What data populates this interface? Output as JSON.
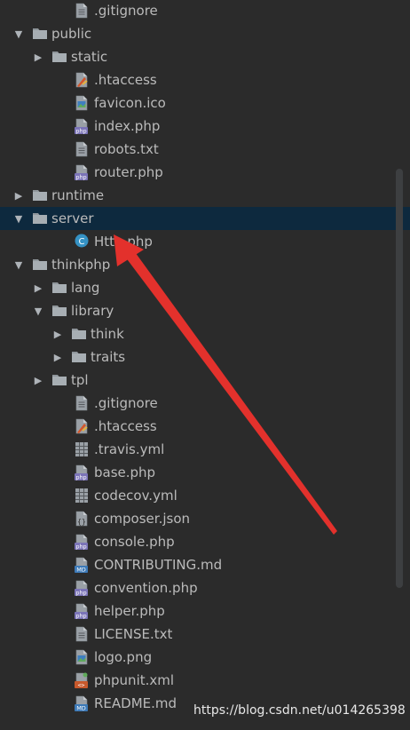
{
  "tree": [
    {
      "label": ".gitignore",
      "depth": 2,
      "arrow": "",
      "icon": "text-file-icon"
    },
    {
      "label": "public",
      "depth": 0,
      "arrow": "expanded",
      "icon": "folder-icon"
    },
    {
      "label": "static",
      "depth": 1,
      "arrow": "collapsed",
      "icon": "folder-icon"
    },
    {
      "label": ".htaccess",
      "depth": 2,
      "arrow": "",
      "icon": "htaccess-file-icon"
    },
    {
      "label": "favicon.ico",
      "depth": 2,
      "arrow": "",
      "icon": "image-file-icon"
    },
    {
      "label": "index.php",
      "depth": 2,
      "arrow": "",
      "icon": "php-file-icon"
    },
    {
      "label": "robots.txt",
      "depth": 2,
      "arrow": "",
      "icon": "text-file-icon"
    },
    {
      "label": "router.php",
      "depth": 2,
      "arrow": "",
      "icon": "php-file-icon"
    },
    {
      "label": "runtime",
      "depth": 0,
      "arrow": "collapsed",
      "icon": "folder-icon"
    },
    {
      "label": "server",
      "depth": 0,
      "arrow": "expanded",
      "icon": "folder-icon",
      "selected": true
    },
    {
      "label": "Http.php",
      "depth": 2,
      "arrow": "",
      "icon": "php-class-icon"
    },
    {
      "label": "thinkphp",
      "depth": 0,
      "arrow": "expanded",
      "icon": "folder-icon"
    },
    {
      "label": "lang",
      "depth": 1,
      "arrow": "collapsed",
      "icon": "folder-icon"
    },
    {
      "label": "library",
      "depth": 1,
      "arrow": "expanded",
      "icon": "folder-icon"
    },
    {
      "label": "think",
      "depth": 2,
      "arrow": "collapsed",
      "icon": "folder-icon"
    },
    {
      "label": "traits",
      "depth": 2,
      "arrow": "collapsed",
      "icon": "folder-icon"
    },
    {
      "label": "tpl",
      "depth": 1,
      "arrow": "collapsed",
      "icon": "folder-icon"
    },
    {
      "label": ".gitignore",
      "depth": 2,
      "arrow": "",
      "icon": "text-file-icon"
    },
    {
      "label": ".htaccess",
      "depth": 2,
      "arrow": "",
      "icon": "htaccess-file-icon"
    },
    {
      "label": ".travis.yml",
      "depth": 2,
      "arrow": "",
      "icon": "yml-file-icon"
    },
    {
      "label": "base.php",
      "depth": 2,
      "arrow": "",
      "icon": "php-file-icon"
    },
    {
      "label": "codecov.yml",
      "depth": 2,
      "arrow": "",
      "icon": "yml-file-icon"
    },
    {
      "label": "composer.json",
      "depth": 2,
      "arrow": "",
      "icon": "json-file-icon"
    },
    {
      "label": "console.php",
      "depth": 2,
      "arrow": "",
      "icon": "php-file-icon"
    },
    {
      "label": "CONTRIBUTING.md",
      "depth": 2,
      "arrow": "",
      "icon": "markdown-file-icon"
    },
    {
      "label": "convention.php",
      "depth": 2,
      "arrow": "",
      "icon": "php-file-icon"
    },
    {
      "label": "helper.php",
      "depth": 2,
      "arrow": "",
      "icon": "php-file-icon"
    },
    {
      "label": "LICENSE.txt",
      "depth": 2,
      "arrow": "",
      "icon": "text-file-icon"
    },
    {
      "label": "logo.png",
      "depth": 2,
      "arrow": "",
      "icon": "image-file-icon"
    },
    {
      "label": "phpunit.xml",
      "depth": 2,
      "arrow": "",
      "icon": "xml-file-icon"
    },
    {
      "label": "README.md",
      "depth": 2,
      "arrow": "",
      "icon": "markdown-file-icon"
    }
  ],
  "watermark": "https://blog.csdn.net/u014265398",
  "colors": {
    "background": "#2b2b2b",
    "selected_row": "#0d293e",
    "text": "#bbbbbb",
    "folder": "#8f969b",
    "php_badge": "#7b74b8",
    "annotation_arrow": "#e3312c"
  }
}
